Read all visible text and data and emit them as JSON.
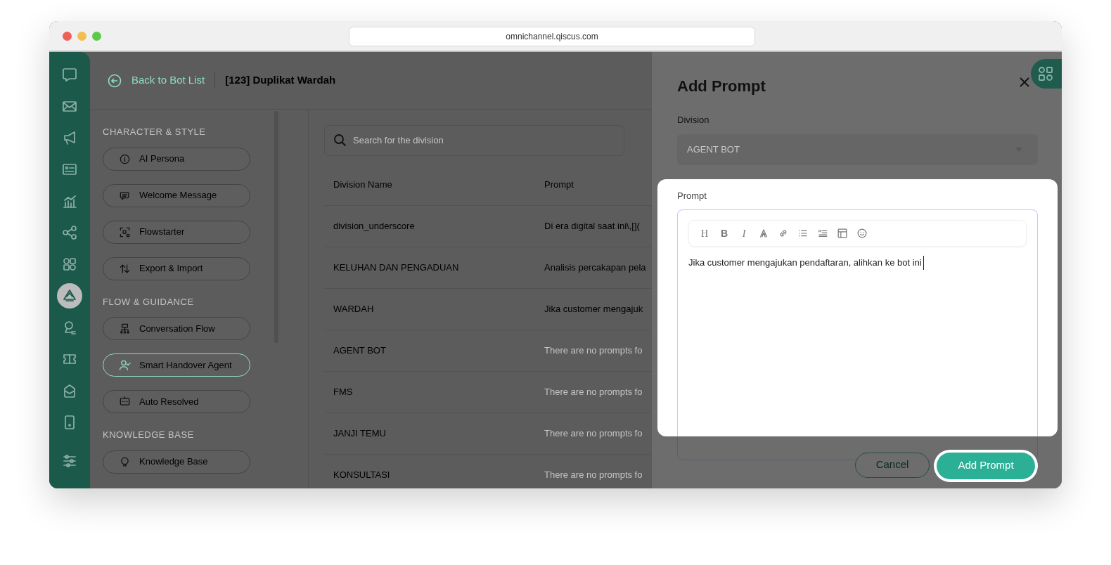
{
  "browser": {
    "url": "omnichannel.qiscus.com"
  },
  "rail": {
    "items": [
      {
        "selected": false
      },
      {
        "selected": false
      },
      {
        "selected": false
      },
      {
        "selected": false
      },
      {
        "selected": false
      },
      {
        "selected": false
      },
      {
        "selected": false
      },
      {
        "selected": true
      },
      {
        "selected": false
      },
      {
        "selected": false
      },
      {
        "selected": false
      },
      {
        "selected": false
      },
      {
        "selected": false
      }
    ]
  },
  "header": {
    "back_link": "Back to Bot List",
    "title": "[123] Duplikat Wardah"
  },
  "sidebar": {
    "sections": [
      {
        "heading": "CHARACTER & STYLE",
        "items": [
          {
            "label": "AI Persona",
            "selected": false
          },
          {
            "label": "Welcome Message",
            "selected": false
          },
          {
            "label": "Flowstarter",
            "selected": false
          },
          {
            "label": "Export & Import",
            "selected": false
          }
        ]
      },
      {
        "heading": "FLOW & GUIDANCE",
        "items": [
          {
            "label": "Conversation Flow",
            "selected": false
          },
          {
            "label": "Smart Handover Agent",
            "selected": true
          },
          {
            "label": "Auto Resolved",
            "selected": false
          }
        ]
      },
      {
        "heading": "KNOWLEDGE BASE",
        "items": [
          {
            "label": "Knowledge Base",
            "selected": false
          }
        ]
      }
    ]
  },
  "search": {
    "placeholder": "Search for the division"
  },
  "table": {
    "columns": [
      "Division Name",
      "Prompt"
    ],
    "rows": [
      {
        "division": "division_underscore",
        "prompt": "Di era digital saat ini\\,[](",
        "muted": false
      },
      {
        "division": "KELUHAN DAN PENGADUAN",
        "prompt": "Analisis percakapan pela",
        "muted": false
      },
      {
        "division": "WARDAH",
        "prompt": "Jika customer mengajuk",
        "muted": false
      },
      {
        "division": "AGENT BOT",
        "prompt": "There are no prompts fo",
        "muted": true
      },
      {
        "division": "FMS",
        "prompt": "There are no prompts fo",
        "muted": true
      },
      {
        "division": "JANJI TEMU",
        "prompt": "There are no prompts fo",
        "muted": true
      },
      {
        "division": "KONSULTASI",
        "prompt": "There are no prompts fo",
        "muted": true
      }
    ]
  },
  "drawer": {
    "title": "Add Prompt",
    "division_label": "Division",
    "division_value": "AGENT BOT",
    "prompt_label": "Prompt",
    "toolbar_letters": [
      "H",
      "B",
      "I"
    ],
    "editor_value": "Jika customer mengajukan pendaftaran, alihkan ke bot ini",
    "buttons": {
      "cancel": "Cancel",
      "submit": "Add Prompt"
    }
  }
}
